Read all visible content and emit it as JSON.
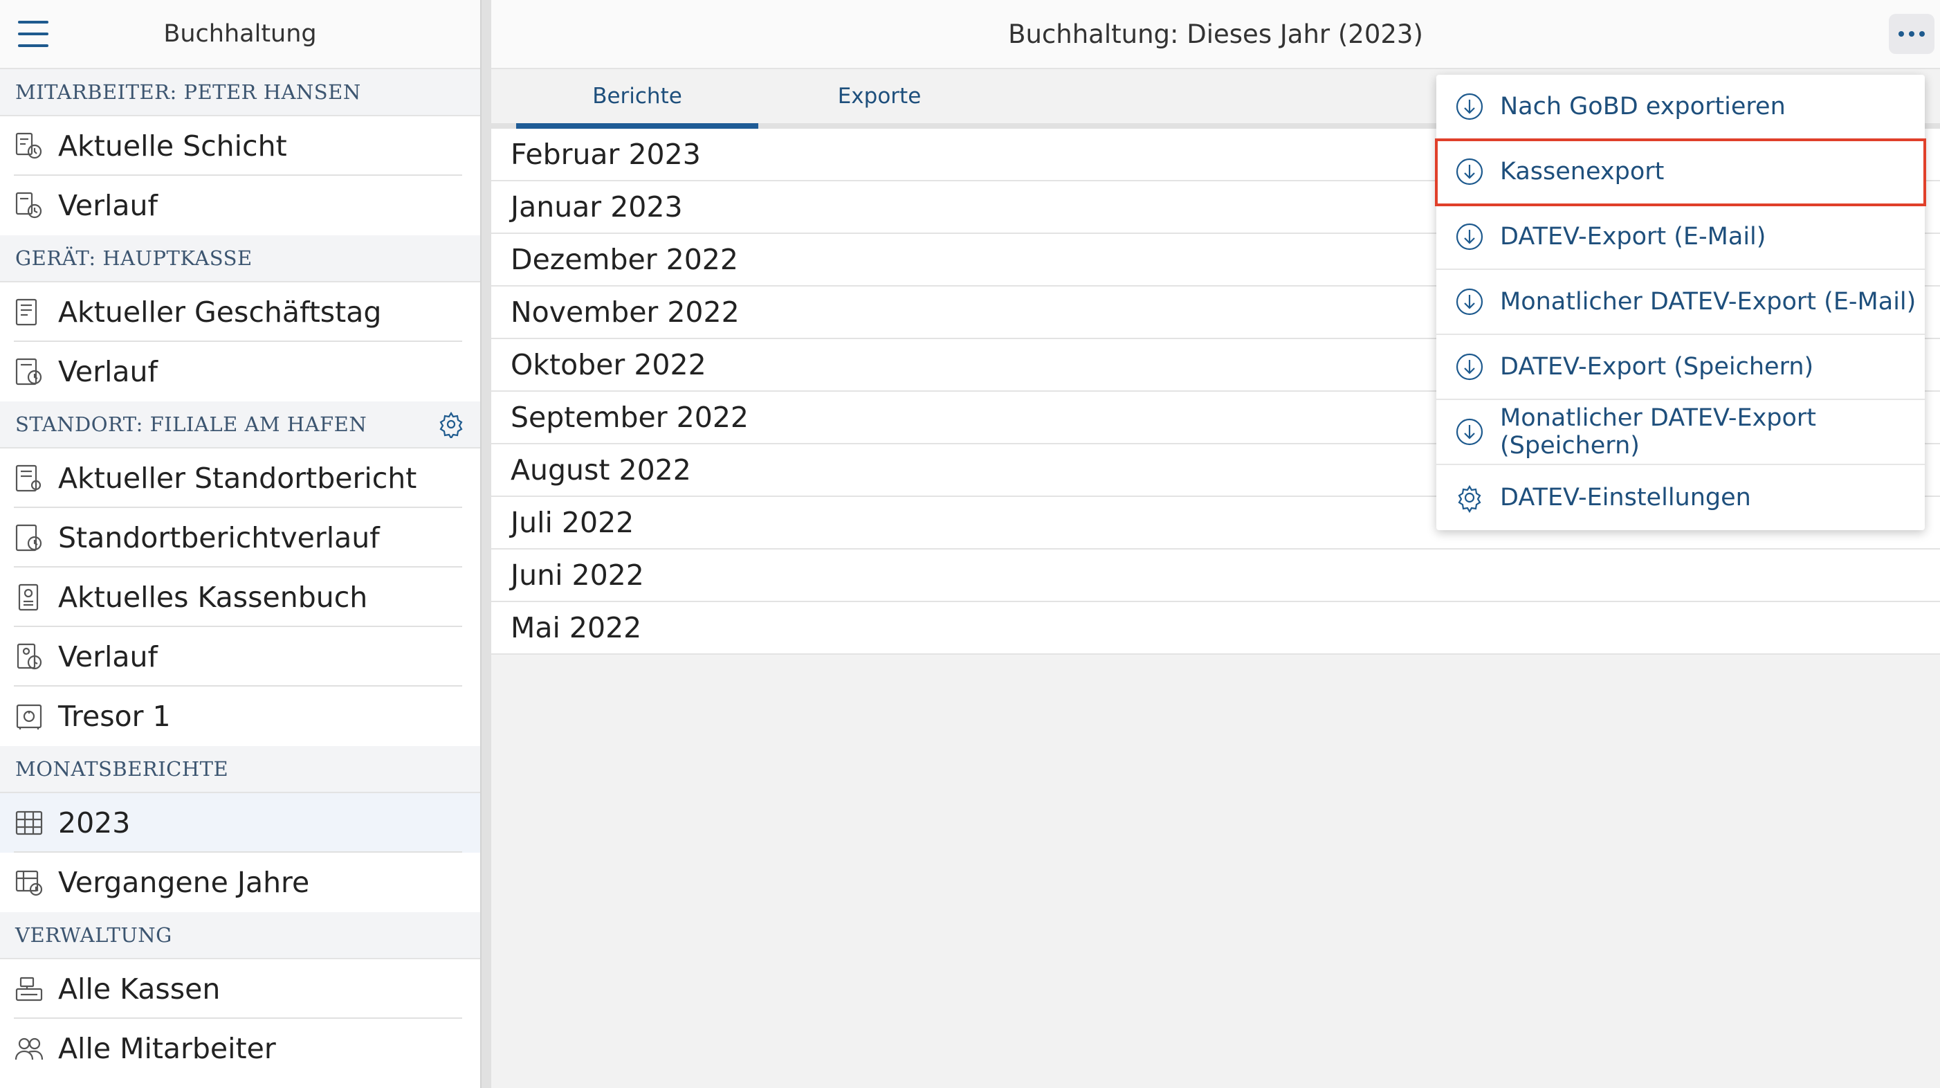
{
  "colors": {
    "accent": "#1e5a8e",
    "highlight": "#e0402a",
    "section_text": "#3c5570"
  },
  "sidebar": {
    "title": "Buchhaltung",
    "sections": {
      "employee": {
        "header": "MITARBEITER: PETER HANSEN",
        "items": [
          {
            "label": "Aktuelle Schicht",
            "icon": "shift-icon"
          },
          {
            "label": "Verlauf",
            "icon": "history-icon"
          }
        ]
      },
      "device": {
        "header": "GERÄT: HAUPTKASSE",
        "items": [
          {
            "label": "Aktueller Geschäftstag",
            "icon": "report-icon"
          },
          {
            "label": "Verlauf",
            "icon": "history-icon"
          }
        ]
      },
      "location": {
        "header": "STANDORT: FILIALE AM HAFEN",
        "settings_icon": "gear-icon",
        "items": [
          {
            "label": "Aktueller Standortbericht",
            "icon": "report-icon"
          },
          {
            "label": "Standortberichtverlauf",
            "icon": "history-icon"
          },
          {
            "label": "Aktuelles Kassenbuch",
            "icon": "cashbook-icon"
          },
          {
            "label": "Verlauf",
            "icon": "history-icon"
          },
          {
            "label": "Tresor 1",
            "icon": "safe-icon"
          }
        ]
      },
      "monthly": {
        "header": "MONATSBERICHTE",
        "items": [
          {
            "label": "2023",
            "icon": "calendar-icon",
            "active": true
          },
          {
            "label": "Vergangene Jahre",
            "icon": "calendar-history-icon"
          }
        ]
      },
      "admin": {
        "header": "VERWALTUNG",
        "items": [
          {
            "label": "Alle Kassen",
            "icon": "register-icon"
          },
          {
            "label": "Alle Mitarbeiter",
            "icon": "people-icon"
          }
        ]
      }
    }
  },
  "main": {
    "title": "Buchhaltung: Dieses Jahr (2023)",
    "tabs": [
      {
        "label": "Berichte",
        "active": true
      },
      {
        "label": "Exporte",
        "active": false
      }
    ],
    "months": [
      "Februar 2023",
      "Januar 2023",
      "Dezember 2022",
      "November 2022",
      "Oktober 2022",
      "September 2022",
      "August 2022",
      "Juli 2022",
      "Juni 2022",
      "Mai 2022"
    ]
  },
  "menu": {
    "items": [
      {
        "label": "Nach GoBD exportieren",
        "icon": "download-icon"
      },
      {
        "label": "Kassenexport",
        "icon": "download-icon",
        "highlighted": true
      },
      {
        "label": "DATEV-Export (E-Mail)",
        "icon": "download-icon"
      },
      {
        "label": "Monatlicher DATEV-Export (E-Mail)",
        "icon": "download-icon"
      },
      {
        "label": "DATEV-Export (Speichern)",
        "icon": "download-icon"
      },
      {
        "label": "Monatlicher DATEV-Export (Speichern)",
        "icon": "download-icon"
      },
      {
        "label": "DATEV-Einstellungen",
        "icon": "gear-icon"
      }
    ]
  }
}
